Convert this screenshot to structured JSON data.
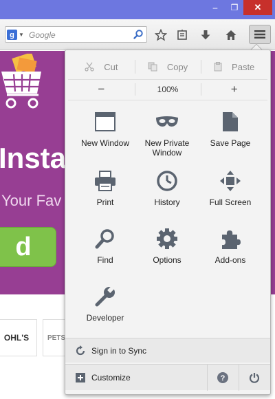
{
  "browser": {
    "search": {
      "placeholder": "Google",
      "engine_letter": "g"
    },
    "window_buttons": {
      "minimize": "–",
      "maximize": "❐",
      "close": "✕"
    }
  },
  "webpage": {
    "heading": "Insta",
    "subtitle": "Your Fav",
    "cta_label": "d",
    "logos": [
      "OHL'S",
      "PETS"
    ]
  },
  "menu_panel": {
    "edit": {
      "cut": "Cut",
      "copy": "Copy",
      "paste": "Paste"
    },
    "zoom": {
      "minus": "−",
      "level": "100%",
      "plus": "+"
    },
    "items": [
      {
        "label": "New Window",
        "icon": "window-icon"
      },
      {
        "label": "New Private Window",
        "icon": "mask-icon"
      },
      {
        "label": "Save Page",
        "icon": "page-icon"
      },
      {
        "label": "Print",
        "icon": "printer-icon"
      },
      {
        "label": "History",
        "icon": "clock-icon"
      },
      {
        "label": "Full Screen",
        "icon": "fullscreen-icon"
      },
      {
        "label": "Find",
        "icon": "magnifier-icon"
      },
      {
        "label": "Options",
        "icon": "gear-icon"
      },
      {
        "label": "Add-ons",
        "icon": "puzzle-icon"
      },
      {
        "label": "Developer",
        "icon": "wrench-icon"
      }
    ],
    "sync_label": "Sign in to Sync",
    "customize_label": "Customize"
  },
  "colors": {
    "titlebar": "#6d77e0",
    "page_purple": "#973e93",
    "cta_green": "#7fc24a",
    "panel_bg": "#f3f3f3",
    "icon_gray": "#5b6470"
  }
}
